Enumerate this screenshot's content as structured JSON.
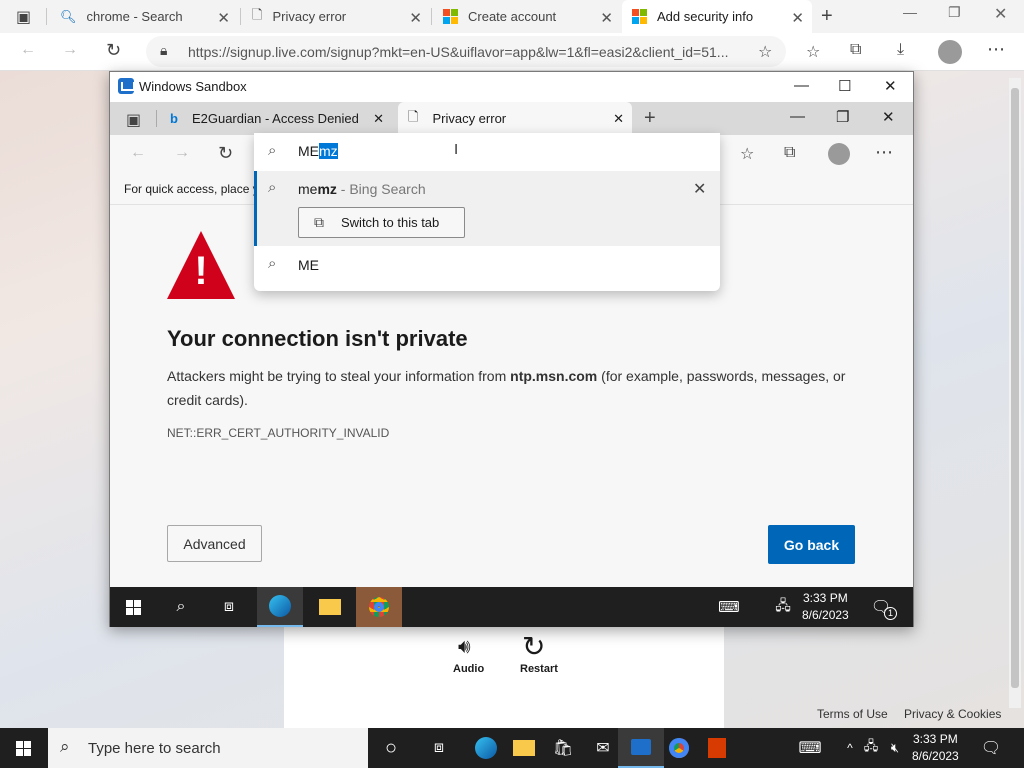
{
  "host_browser": {
    "tabs": [
      {
        "title": "chrome - Search"
      },
      {
        "title": "Privacy error"
      },
      {
        "title": "Create account"
      },
      {
        "title": "Add security info"
      }
    ],
    "url": "https://signup.live.com/signup?mkt=en-US&uiflavor=app&lw=1&fl=easi2&client_id=51..."
  },
  "background_page": {
    "audio_label": "Audio",
    "restart_label": "Restart",
    "terms_link": "Terms of Use",
    "privacy_link": "Privacy & Cookies"
  },
  "sandbox": {
    "title": "Windows Sandbox",
    "tabs": [
      {
        "title": "E2Guardian - Access Denied"
      },
      {
        "title": "Privacy error"
      }
    ],
    "favbar_text": "For quick access, place y",
    "error": {
      "heading": "Your connection isn't private",
      "text_before": "Attackers might be trying to steal your information from ",
      "domain": "ntp.msn.com",
      "text_after": " (for example, passwords, messages, or credit cards).",
      "code": "NET::ERR_CERT_AUTHORITY_INVALID",
      "advanced_label": "Advanced",
      "goback_label": "Go back"
    },
    "taskbar": {
      "time": "3:33 PM",
      "date": "8/6/2023",
      "notif_count": "1"
    }
  },
  "omnibox": {
    "typed": "ME",
    "autocomplete": "mz",
    "suggestion1_prefix": "me",
    "suggestion1_bold": "mz",
    "suggestion1_suffix": " - Bing Search",
    "switch_tab_label": "Switch to this tab",
    "suggestion2": "ME"
  },
  "host_taskbar": {
    "search_placeholder": "Type here to search",
    "time": "3:33 PM",
    "date": "8/6/2023"
  },
  "colors": {
    "accent": "#0067b8",
    "warning": "#d0021b",
    "taskbar": "#1f1f1f"
  }
}
